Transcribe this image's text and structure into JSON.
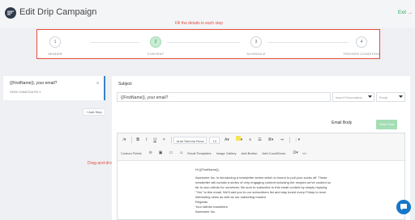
{
  "header": {
    "title": "Edit Drip Campaign",
    "exit_label": "Exit",
    "exit_arrow": "→"
  },
  "annotations": {
    "top": "Fill the details in each step",
    "left": "Drag-and-drop editor"
  },
  "steps": [
    {
      "num": "1",
      "label": "SENDER"
    },
    {
      "num": "2",
      "label": "CONTENT"
    },
    {
      "num": "3",
      "label": "SCHEDULE"
    },
    {
      "num": "4",
      "label": "TRIGGER CONDITION"
    }
  ],
  "active_step": 2,
  "sidebar": {
    "step_subject": "{{FirstName}}, your email?",
    "send_timing": "SEND IMMEDIATELY",
    "menu_icon": "≡",
    "add_step_label": "+ Add Step"
  },
  "subject": {
    "label": "Subject",
    "value": "{{FirstName}}, your email?",
    "personalize_placeholder": "Insert Personaliza...",
    "emoji_placeholder": "Emoji"
  },
  "email_body": {
    "label": "Email Body",
    "send_test_label": "Send Test"
  },
  "toolbar": {
    "row1": {
      "font_family": "Arial Tahoma Rosa",
      "font_size": "13"
    },
    "row2": {
      "custom_fields": "Custom Fields",
      "email_templates": "Email Templates",
      "image_gallery": "Image Gallery",
      "add_button": "Add Button",
      "add_countdown": "Add CountDown",
      "code": "</>"
    }
  },
  "content": {
    "greeting": "Hi {{FirstName}},",
    "paragraph": "Awesome Inc. is introducing a newsletter series which is bound to pull your socks off. These newsletter will contain a series of very engaging content including the recipes we've cooked so far to woo clients for ourselves. Be sure to subscribe to this email content by simply replying \"Yes\" to this email. We'll add you to our subscribers list and stay tuned every Friday to read interesting news as well as our marketing mantra.",
    "regards": "Regards",
    "signoff": "Your faithful marketers",
    "company": "Awesome Inc."
  },
  "colors": {
    "accent_green": "#27ae60",
    "annotation_red": "#e74c3c",
    "primary_blue": "#1677c9"
  }
}
